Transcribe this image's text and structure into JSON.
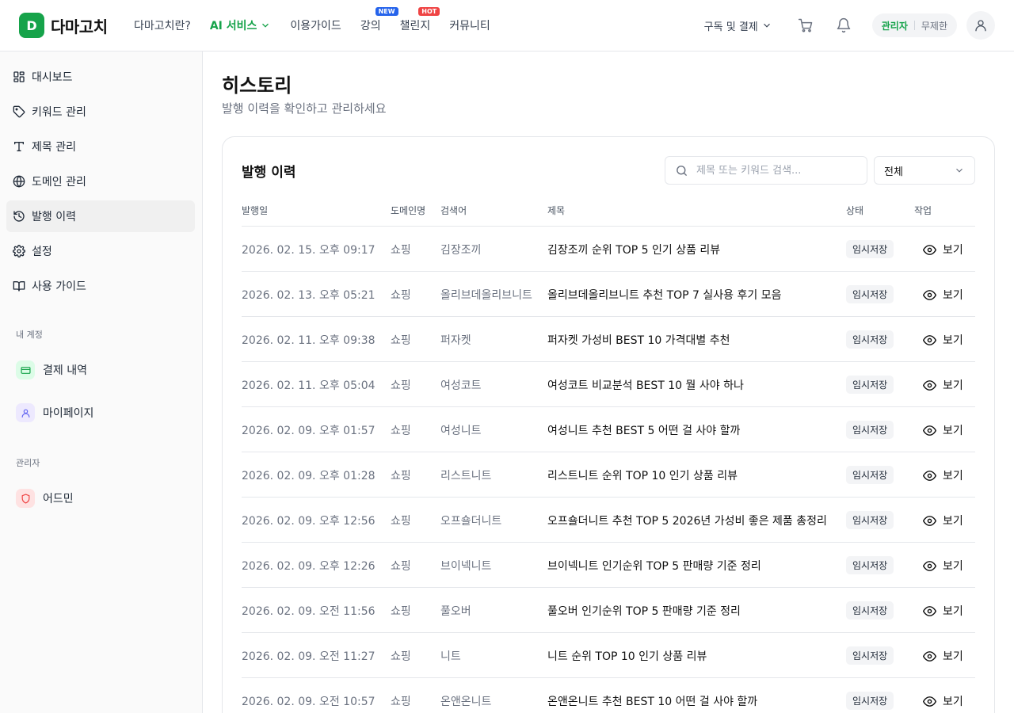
{
  "brand": {
    "logo_letter": "D",
    "name": "다마고치",
    "color": "#16a34a"
  },
  "nav": {
    "items": [
      {
        "label": "다마고치란?",
        "active": false,
        "badge": ""
      },
      {
        "label": "AI 서비스",
        "active": true,
        "badge": ""
      },
      {
        "label": "이용가이드",
        "active": false,
        "badge": ""
      },
      {
        "label": "강의",
        "active": false,
        "badge": "NEW"
      },
      {
        "label": "챌린지",
        "active": false,
        "badge": "HOT"
      },
      {
        "label": "커뮤니티",
        "active": false,
        "badge": ""
      }
    ],
    "subscription": "구독 및 결제",
    "role": "관리자",
    "plan": "무제한"
  },
  "sidebar": {
    "items": [
      {
        "label": "대시보드",
        "icon": "dashboard-icon"
      },
      {
        "label": "키워드 관리",
        "icon": "tag-icon"
      },
      {
        "label": "제목 관리",
        "icon": "type-icon"
      },
      {
        "label": "도메인 관리",
        "icon": "globe-icon"
      },
      {
        "label": "발행 이력",
        "icon": "history-icon",
        "active": true
      },
      {
        "label": "설정",
        "icon": "gear-icon"
      },
      {
        "label": "사용 가이드",
        "icon": "book-icon"
      }
    ],
    "account_section": "내 계정",
    "account_items": [
      {
        "label": "결제 내역",
        "icon": "card-icon"
      },
      {
        "label": "마이페이지",
        "icon": "user-icon"
      }
    ],
    "admin_section": "관리자",
    "admin_items": [
      {
        "label": "어드민",
        "icon": "shield-icon"
      }
    ]
  },
  "page": {
    "title": "히스토리",
    "subtitle": "발행 이력을 확인하고 관리하세요"
  },
  "history": {
    "title": "발행 이력",
    "search_placeholder": "제목 또는 키워드 검색...",
    "filter_value": "전체",
    "columns": [
      "발행일",
      "도메인명",
      "검색어",
      "제목",
      "상태",
      "작업"
    ],
    "rows": [
      {
        "date": "2026. 02. 15. 오후 09:17",
        "domain": "쇼핑",
        "keyword": "김장조끼",
        "title": "김장조끼 순위 TOP 5 인기 상품 리뷰",
        "status": "임시저장",
        "action": "보기"
      },
      {
        "date": "2026. 02. 13. 오후 05:21",
        "domain": "쇼핑",
        "keyword": "올리브데올리브니트",
        "title": "올리브데올리브니트 추천 TOP 7 실사용 후기 모음",
        "status": "임시저장",
        "action": "보기"
      },
      {
        "date": "2026. 02. 11. 오후 09:38",
        "domain": "쇼핑",
        "keyword": "퍼자켓",
        "title": "퍼자켓 가성비 BEST 10 가격대별 추천",
        "status": "임시저장",
        "action": "보기"
      },
      {
        "date": "2026. 02. 11. 오후 05:04",
        "domain": "쇼핑",
        "keyword": "여성코트",
        "title": "여성코트 비교분석 BEST 10 뭘 사야 하나",
        "status": "임시저장",
        "action": "보기"
      },
      {
        "date": "2026. 02. 09. 오후 01:57",
        "domain": "쇼핑",
        "keyword": "여성니트",
        "title": "여성니트 추천 BEST 5 어떤 걸 사야 할까",
        "status": "임시저장",
        "action": "보기"
      },
      {
        "date": "2026. 02. 09. 오후 01:28",
        "domain": "쇼핑",
        "keyword": "리스트니트",
        "title": "리스트니트 순위 TOP 10 인기 상품 리뷰",
        "status": "임시저장",
        "action": "보기"
      },
      {
        "date": "2026. 02. 09. 오후 12:56",
        "domain": "쇼핑",
        "keyword": "오프숄더니트",
        "title": "오프숄더니트 추천 TOP 5 2026년 가성비 좋은 제품 총정리",
        "status": "임시저장",
        "action": "보기"
      },
      {
        "date": "2026. 02. 09. 오후 12:26",
        "domain": "쇼핑",
        "keyword": "브이넥니트",
        "title": "브이넥니트 인기순위 TOP 5 판매량 기준 정리",
        "status": "임시저장",
        "action": "보기"
      },
      {
        "date": "2026. 02. 09. 오전 11:56",
        "domain": "쇼핑",
        "keyword": "풀오버",
        "title": "풀오버 인기순위 TOP 5 판매량 기준 정리",
        "status": "임시저장",
        "action": "보기"
      },
      {
        "date": "2026. 02. 09. 오전 11:27",
        "domain": "쇼핑",
        "keyword": "니트",
        "title": "니트 순위 TOP 10 인기 상품 리뷰",
        "status": "임시저장",
        "action": "보기"
      },
      {
        "date": "2026. 02. 09. 오전 10:57",
        "domain": "쇼핑",
        "keyword": "온앤온니트",
        "title": "온앤온니트 추천 BEST 10 어떤 걸 사야 할까",
        "status": "임시저장",
        "action": "보기"
      }
    ]
  }
}
